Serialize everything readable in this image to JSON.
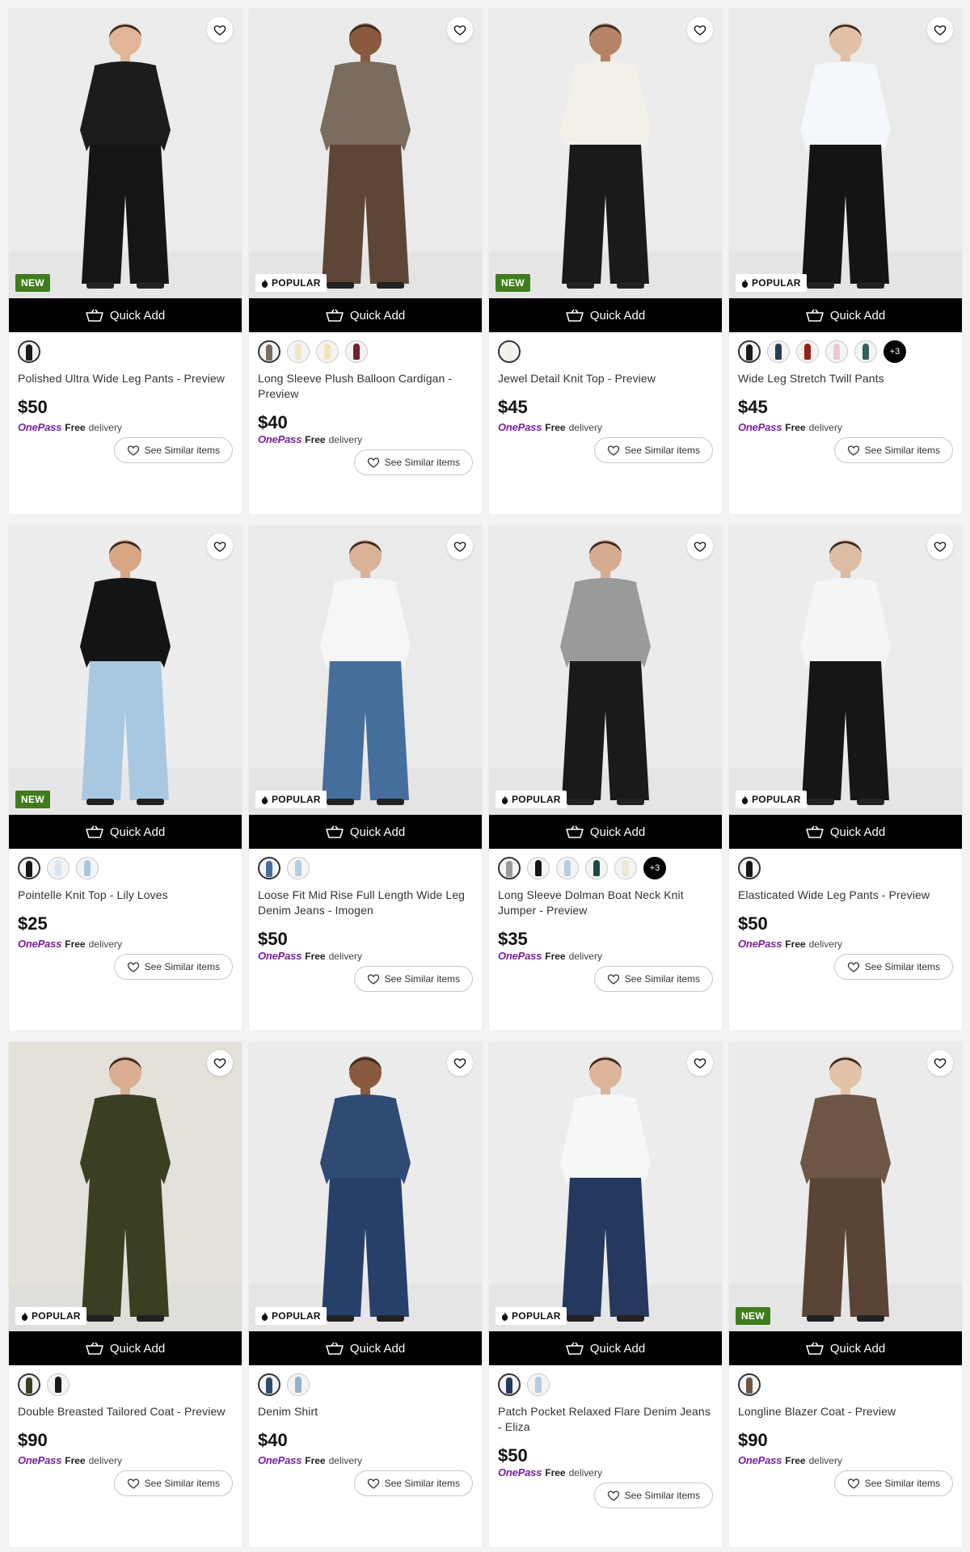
{
  "colors": {
    "new_badge": "#3f7d1b",
    "onepass": "#7b1fa2",
    "quick_add_bg": "#000000"
  },
  "labels": {
    "quick_add": "Quick Add",
    "onepass": "OnePass",
    "free": "Free",
    "delivery": "delivery",
    "see_similar": "See Similar items"
  },
  "products": [
    {
      "name": "Polished Ultra Wide Leg Pants - Preview",
      "price": "$50",
      "badge": "NEW",
      "bg": "#ececec",
      "top": "#1c1c1c",
      "bottom": "#151515",
      "skin": "#e2b597",
      "swatches": [
        {
          "color": "#1a1a1a",
          "selected": true
        }
      ]
    },
    {
      "name": "Long Sleeve Plush Balloon Cardigan - Preview",
      "price": "$40",
      "badge": "POPULAR",
      "bg": "#eaeaea",
      "top": "#7a6c5e",
      "bottom": "#5e4637",
      "skin": "#8a5a3e",
      "swatches": [
        {
          "color": "#7a6c5e",
          "selected": true
        },
        {
          "color": "#efe6cc"
        },
        {
          "color": "#f0e6b8"
        },
        {
          "color": "#7a1e2c"
        }
      ]
    },
    {
      "name": "Jewel Detail Knit Top - Preview",
      "price": "$45",
      "badge": "NEW",
      "bg": "#ececec",
      "top": "#f2f0e8",
      "bottom": "#1a1a1a",
      "skin": "#b78366",
      "swatches": [
        {
          "color": "#f2f0e8",
          "selected": true
        }
      ]
    },
    {
      "name": "Wide Leg Stretch Twill Pants",
      "price": "$45",
      "badge": "POPULAR",
      "bg": "#eaeaea",
      "top": "#f4f7fb",
      "bottom": "#141414",
      "skin": "#e2c0a6",
      "swatches": [
        {
          "color": "#1a1a1a",
          "selected": true
        },
        {
          "color": "#2b3b50"
        },
        {
          "color": "#9b1e15"
        },
        {
          "color": "#e9c9d0"
        },
        {
          "color": "#345e5a"
        }
      ],
      "more": "+3"
    },
    {
      "name": "Pointelle Knit Top - Lily Loves",
      "price": "$25",
      "badge": "NEW",
      "bg": "#ededed",
      "top": "#141414",
      "bottom": "#a8c8e2",
      "skin": "#d8a683",
      "swatches": [
        {
          "color": "#141414",
          "selected": true
        },
        {
          "color": "#d7e6f2"
        },
        {
          "color": "#a8c8e2"
        }
      ]
    },
    {
      "name": "Loose Fit Mid Rise Full Length Wide Leg Denim Jeans - Imogen",
      "price": "$50",
      "badge": "POPULAR",
      "bg": "#eaeaea",
      "top": "#f6f6f6",
      "bottom": "#466e9c",
      "skin": "#d9b298",
      "swatches": [
        {
          "color": "#466e9c",
          "selected": true
        },
        {
          "color": "#b6cbe0"
        }
      ]
    },
    {
      "name": "Long Sleeve Dolman Boat Neck Knit Jumper - Preview",
      "price": "$35",
      "badge": "POPULAR",
      "bg": "#ebebeb",
      "top": "#9a9a9a",
      "bottom": "#1a1a1a",
      "skin": "#d6ac90",
      "swatches": [
        {
          "color": "#9a9a9a",
          "selected": true
        },
        {
          "color": "#141414"
        },
        {
          "color": "#b8cce2"
        },
        {
          "color": "#1f4a44"
        },
        {
          "color": "#ece6d6"
        }
      ],
      "more": "+3"
    },
    {
      "name": "Elasticated Wide Leg Pants - Preview",
      "price": "$50",
      "badge": "POPULAR",
      "bg": "#ececec",
      "top": "#f5f5f5",
      "bottom": "#161616",
      "skin": "#dcbca4",
      "swatches": [
        {
          "color": "#161616",
          "selected": true
        }
      ]
    },
    {
      "name": "Double Breasted Tailored Coat - Preview",
      "price": "$90",
      "badge": "POPULAR",
      "bg": "#e4e0da",
      "top": "#3b3f22",
      "bottom": "#3b3f22",
      "skin": "#d9ae92",
      "swatches": [
        {
          "color": "#3b3f22",
          "selected": true
        },
        {
          "color": "#1a1a1a"
        }
      ]
    },
    {
      "name": "Denim Shirt",
      "price": "$40",
      "badge": "POPULAR",
      "bg": "#ebebeb",
      "top": "#2f4a73",
      "bottom": "#27406a",
      "skin": "#8a5a40",
      "swatches": [
        {
          "color": "#2f4a73",
          "selected": true
        },
        {
          "color": "#8fb2d6"
        }
      ]
    },
    {
      "name": "Patch Pocket Relaxed Flare Denim Jeans - Eliza",
      "price": "$50",
      "badge": "POPULAR",
      "bg": "#ececec",
      "top": "#f7f7f7",
      "bottom": "#25395e",
      "skin": "#dcb49a",
      "swatches": [
        {
          "color": "#25395e",
          "selected": true
        },
        {
          "color": "#b6cbe0"
        }
      ]
    },
    {
      "name": "Longline Blazer Coat - Preview",
      "price": "$90",
      "badge": "NEW",
      "bg": "#ebebeb",
      "top": "#6d5646",
      "bottom": "#5a4436",
      "skin": "#e2c2a8",
      "swatches": [
        {
          "color": "#6d5646",
          "selected": true
        }
      ]
    }
  ]
}
